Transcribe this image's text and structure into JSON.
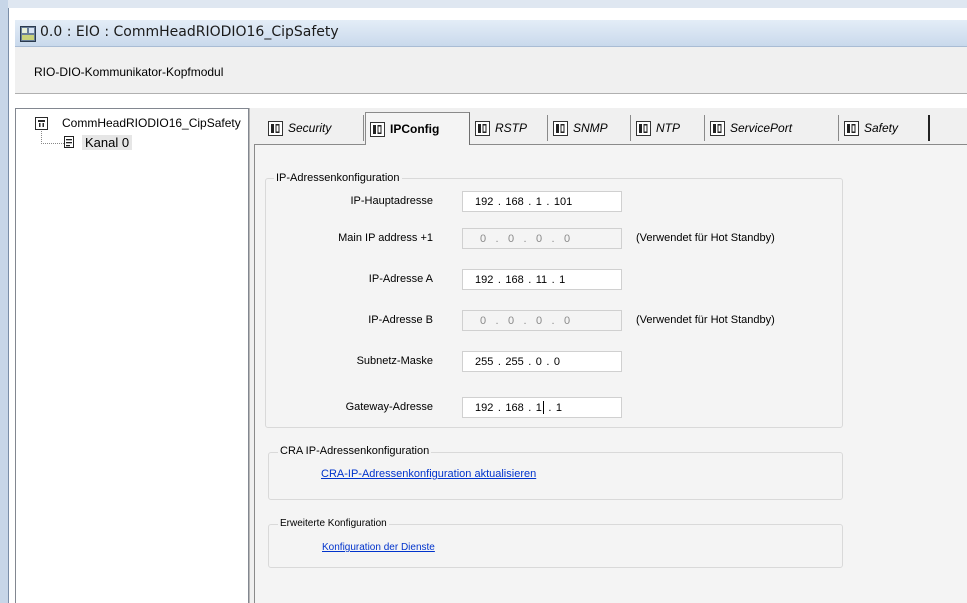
{
  "window": {
    "title": "0.0 : EIO : CommHeadRIODIO16_CipSafety",
    "subtitle": "RIO-DIO-Kommunikator-Kopfmodul"
  },
  "tree": {
    "root_label": "CommHeadRIODIO16_CipSafety",
    "child_label": "Kanal 0"
  },
  "tabs": [
    {
      "label": "Security",
      "active": false
    },
    {
      "label": "IPConfig",
      "active": true
    },
    {
      "label": "RSTP",
      "active": false
    },
    {
      "label": "SNMP",
      "active": false
    },
    {
      "label": "NTP",
      "active": false
    },
    {
      "label": "ServicePort",
      "active": false
    },
    {
      "label": "Safety",
      "active": false
    }
  ],
  "ip_config": {
    "group_title": "IP-Adressenkonfiguration",
    "rows": [
      {
        "label": "IP-Hauptadresse",
        "value": [
          "192",
          "168",
          "1",
          "101"
        ],
        "disabled": false,
        "hint": ""
      },
      {
        "label": "Main IP address +1",
        "value": [
          "0",
          "0",
          "0",
          "0"
        ],
        "disabled": true,
        "hint": "(Verwendet für Hot Standby)"
      },
      {
        "label": "IP-Adresse A",
        "value": [
          "192",
          "168",
          "11",
          "1"
        ],
        "disabled": false,
        "hint": ""
      },
      {
        "label": "IP-Adresse B",
        "value": [
          "0",
          "0",
          "0",
          "0"
        ],
        "disabled": true,
        "hint": "(Verwendet für Hot Standby)"
      },
      {
        "label": "Subnetz-Maske",
        "value": [
          "255",
          "255",
          "0",
          "0"
        ],
        "disabled": false,
        "hint": ""
      },
      {
        "label": "Gateway-Adresse",
        "value": [
          "192",
          "168",
          "1",
          "1"
        ],
        "disabled": false,
        "hint": ""
      }
    ]
  },
  "cra": {
    "group_title": "CRA  IP-Adressenkonfiguration",
    "link": "CRA-IP-Adressenkonfiguration aktualisieren"
  },
  "advanced": {
    "group_title": "Erweiterte Konfiguration",
    "link": "Konfiguration der Dienste"
  }
}
